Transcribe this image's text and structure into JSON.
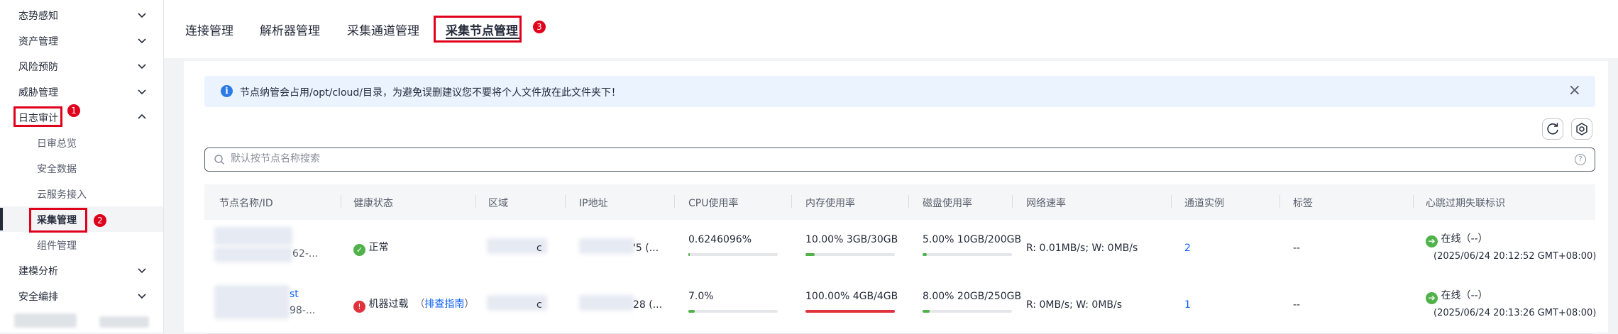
{
  "sidebar": {
    "items": [
      {
        "label": "态势感知",
        "expanded": false
      },
      {
        "label": "资产管理",
        "expanded": false
      },
      {
        "label": "风险预防",
        "expanded": false
      },
      {
        "label": "威胁管理",
        "expanded": false
      },
      {
        "label": "日志审计",
        "expanded": true
      },
      {
        "label": "日审总览"
      },
      {
        "label": "安全数据"
      },
      {
        "label": "云服务接入"
      },
      {
        "label": "采集管理",
        "active": true
      },
      {
        "label": "组件管理"
      },
      {
        "label": "建模分析",
        "expanded": false
      },
      {
        "label": "安全编排",
        "expanded": false
      }
    ]
  },
  "annotations": {
    "b1": "1",
    "b2": "2",
    "b3": "3"
  },
  "tabs": [
    {
      "label": "连接管理"
    },
    {
      "label": "解析器管理"
    },
    {
      "label": "采集通道管理"
    },
    {
      "label": "采集节点管理",
      "active": true
    }
  ],
  "notice": {
    "text": "节点纳管会占用/opt/cloud/目录，为避免误删建议您不要将个人文件放在此文件夹下！"
  },
  "search": {
    "placeholder": "默认按节点名称搜索"
  },
  "table": {
    "columns": [
      "节点名称/ID",
      "健康状态",
      "区域",
      "IP地址",
      "CPU使用率",
      "内存使用率",
      "磁盘使用率",
      "网络速率",
      "通道实例",
      "标签",
      "心跳过期失联标识"
    ],
    "rows": [
      {
        "name_suffix": "62-...",
        "health": "正常",
        "health_status": "ok",
        "region_suffix": "c",
        "ip_suffix": "'5 (...",
        "cpu": "0.6246096%",
        "cpu_fraction": 0.006,
        "mem": "10.00%   3GB/30GB",
        "mem_fraction": 0.1,
        "disk": "5.00%   10GB/200GB",
        "disk_fraction": 0.05,
        "network": "R: 0.01MB/s; W: 0MB/s",
        "channels": "2",
        "tags": "--",
        "heartbeat": "在线（--）",
        "heartbeat_time": "(2025/06/24 20:12:52 GMT+08:00)"
      },
      {
        "name_suffix": "st",
        "name_suffix2": "98-...",
        "health": "机器过载",
        "health_status": "bad",
        "health_guide": "排查指南",
        "region_suffix": "c",
        "ip_suffix": "28 (...",
        "cpu": "7.0%",
        "cpu_fraction": 0.07,
        "mem": "100.00%   4GB/4GB",
        "mem_fraction": 1.0,
        "disk": "8.00%   20GB/250GB",
        "disk_fraction": 0.08,
        "network": "R: 0MB/s; W: 0MB/s",
        "channels": "1",
        "tags": "--",
        "heartbeat": "在线（--）",
        "heartbeat_time": "(2025/06/24 20:13:26 GMT+08:00)"
      }
    ]
  },
  "colors": {
    "accent": "#0f62fe",
    "annotation": "#e0001b",
    "ok": "#50b24a",
    "danger": "#e0323d"
  }
}
